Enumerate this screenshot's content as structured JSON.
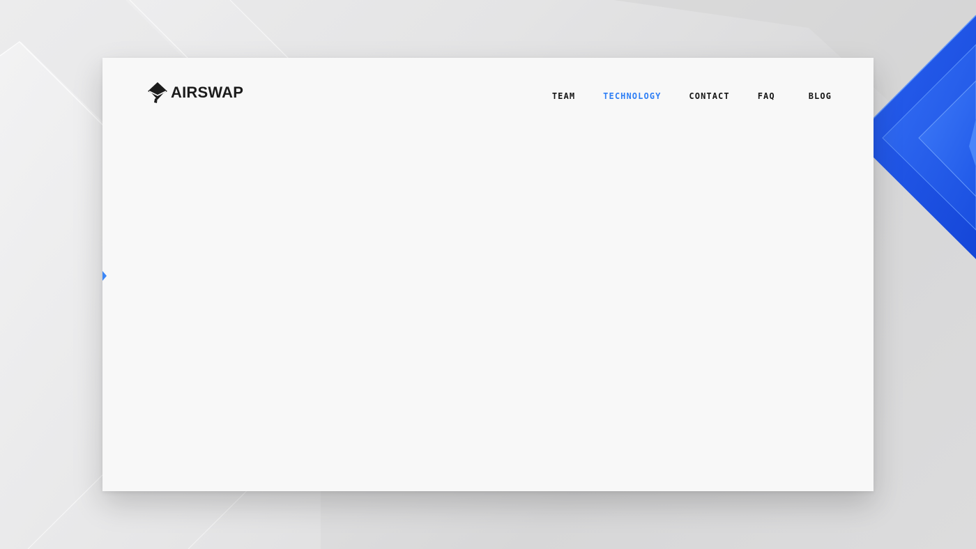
{
  "brand": {
    "name": "AIRSWAP",
    "text_color": "#1c1c1c"
  },
  "nav": {
    "items": [
      {
        "label": "TEAM",
        "active": false
      },
      {
        "label": "TECHNOLOGY",
        "active": true
      },
      {
        "label": "CONTACT",
        "active": false
      },
      {
        "label": "FAQ",
        "active": false
      },
      {
        "label": "BLOG",
        "active": false
      }
    ],
    "active_color": "#2f7ff5",
    "default_color": "#161616"
  },
  "colors": {
    "panel": "#f8f8f8",
    "accent_blue": "#1f5cf0",
    "marker_blue": "#3b86f6"
  },
  "icons": {
    "logo": "airswap-logo-icon",
    "side_marker": "triangle-right-icon"
  }
}
